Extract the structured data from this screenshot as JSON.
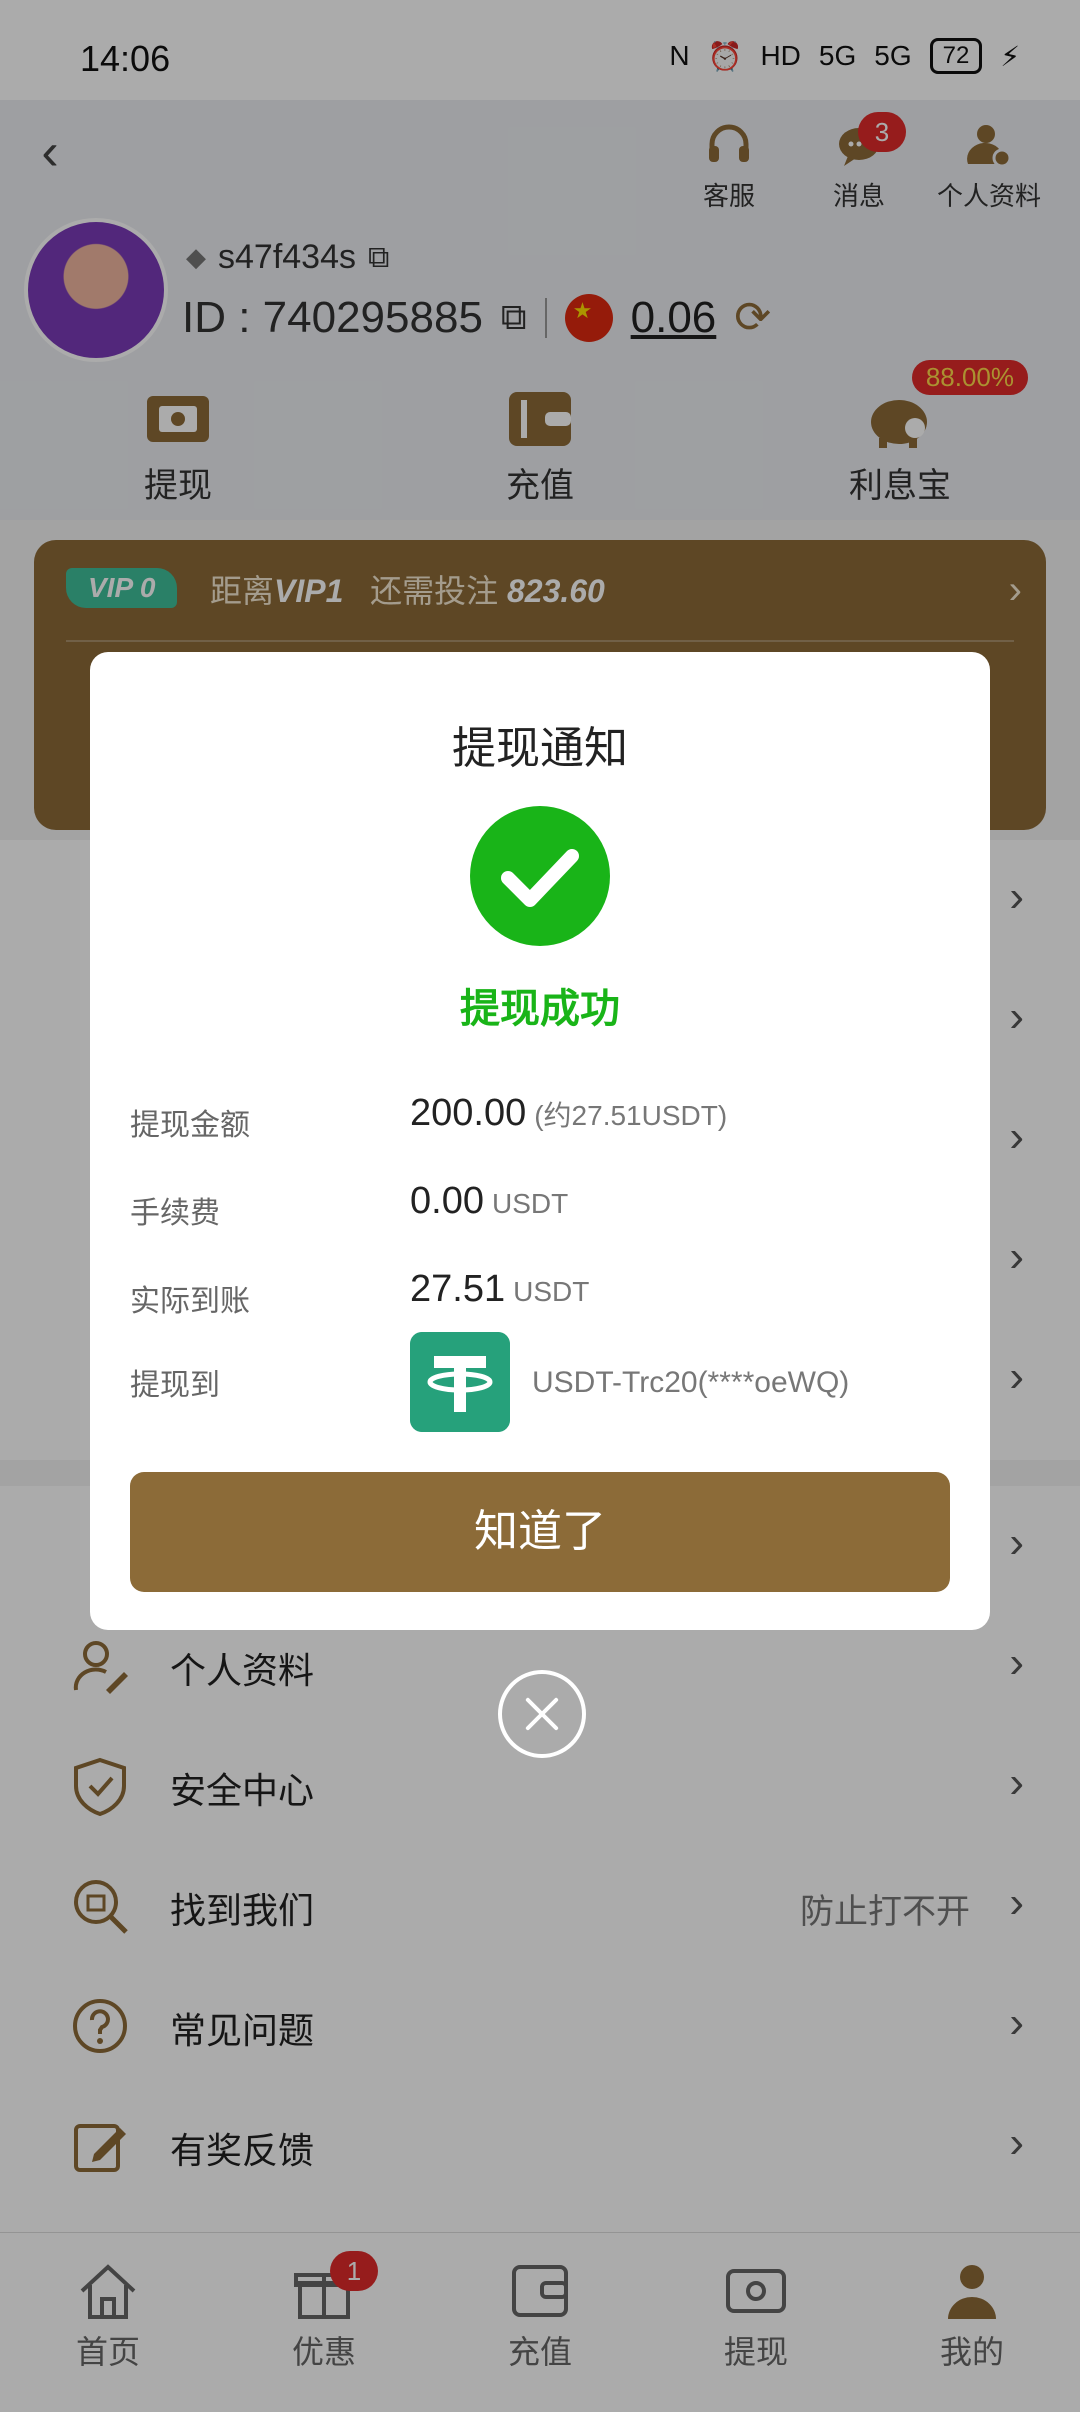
{
  "status_bar": {
    "time": "14:06",
    "battery": "72",
    "net1": "5G",
    "net2": "5G"
  },
  "header": {
    "actions": [
      {
        "label": "客服",
        "icon": "headset-icon"
      },
      {
        "label": "消息",
        "icon": "chat-icon",
        "badge": "3"
      },
      {
        "label": "个人资料",
        "icon": "user-settings-icon"
      }
    ],
    "username": "s47f434s",
    "id_text": "ID : 740295885",
    "balance": "0.06",
    "quick": [
      {
        "label": "提现",
        "icon": "withdraw-icon"
      },
      {
        "label": "充值",
        "icon": "wallet-icon"
      },
      {
        "label": "利息宝",
        "icon": "piggy-bank-icon",
        "badge": "88.00%"
      }
    ]
  },
  "vip": {
    "level": "VIP 0",
    "prefix": "距离",
    "next": "VIP1",
    "need": "还需投注",
    "amount": "823.60"
  },
  "menu": [
    {
      "label": "个人资料",
      "icon": "user-edit-icon"
    },
    {
      "label": "安全中心",
      "icon": "shield-check-icon"
    },
    {
      "label": "找到我们",
      "icon": "search-doc-icon",
      "extra": "防止打不开"
    },
    {
      "label": "常见问题",
      "icon": "question-icon"
    },
    {
      "label": "有奖反馈",
      "icon": "edit-icon"
    }
  ],
  "tabs": [
    {
      "label": "首页",
      "icon": "home-icon"
    },
    {
      "label": "优惠",
      "icon": "gift-icon",
      "badge": "1"
    },
    {
      "label": "充值",
      "icon": "wallet-icon"
    },
    {
      "label": "提现",
      "icon": "withdraw-icon"
    },
    {
      "label": "我的",
      "icon": "profile-icon"
    }
  ],
  "modal": {
    "title": "提现通知",
    "status": "提现成功",
    "rows": [
      {
        "key": "提现金额",
        "value": "200.00",
        "unit": "(约27.51USDT)"
      },
      {
        "key": "手续费",
        "value": "0.00",
        "unit": "USDT"
      },
      {
        "key": "实际到账",
        "value": "27.51",
        "unit": "USDT"
      },
      {
        "key": "提现到",
        "value": "USDT-Trc20(****oeWQ)"
      }
    ],
    "button": "知道了"
  }
}
